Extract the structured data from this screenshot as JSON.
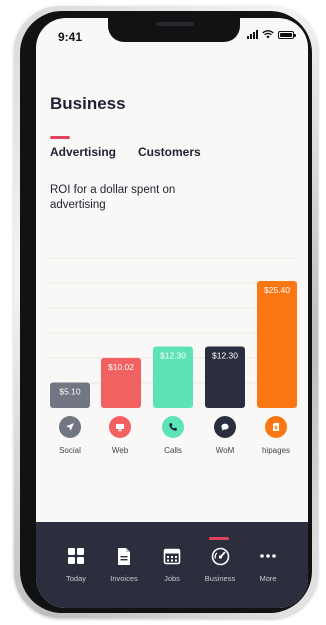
{
  "status": {
    "time": "9:41"
  },
  "page": {
    "title": "Business"
  },
  "tabs": [
    {
      "label": "Advertising",
      "active": true
    },
    {
      "label": "Customers",
      "active": false
    }
  ],
  "section": {
    "description": "ROI for a dollar spent on advertising"
  },
  "chart_data": {
    "type": "bar",
    "categories": [
      "Social",
      "Web",
      "Calls",
      "WoM",
      "hipages"
    ],
    "values": [
      5.1,
      10.02,
      12.3,
      12.3,
      25.4
    ],
    "data_labels": [
      "$5.10",
      "$10.02",
      "$12.30",
      "$12.30",
      "$25.40"
    ],
    "colors": [
      "#727682",
      "#f26161",
      "#5de3b5",
      "#2a2e3f",
      "#fa7713"
    ],
    "ylim": [
      0,
      30
    ],
    "grid": true,
    "title": "",
    "xlabel": "",
    "ylabel": ""
  },
  "channels": [
    {
      "label": "Social",
      "icon": "send-icon",
      "color": "#727682"
    },
    {
      "label": "Web",
      "icon": "monitor-icon",
      "color": "#f26161"
    },
    {
      "label": "Calls",
      "icon": "phone-icon",
      "color": "#5de3b5"
    },
    {
      "label": "WoM",
      "icon": "chat-bubble-icon",
      "color": "#2a2e3f"
    },
    {
      "label": "hipages",
      "icon": "hipages-logo-icon",
      "color": "#fa7713"
    }
  ],
  "nav": {
    "items": [
      {
        "label": "Today",
        "icon": "grid-icon"
      },
      {
        "label": "Invoices",
        "icon": "document-icon"
      },
      {
        "label": "Jobs",
        "icon": "calendar-icon"
      },
      {
        "label": "Business",
        "icon": "speedometer-icon",
        "active": true
      },
      {
        "label": "More",
        "icon": "more-dots-icon"
      }
    ],
    "accent": "#e0435a"
  }
}
